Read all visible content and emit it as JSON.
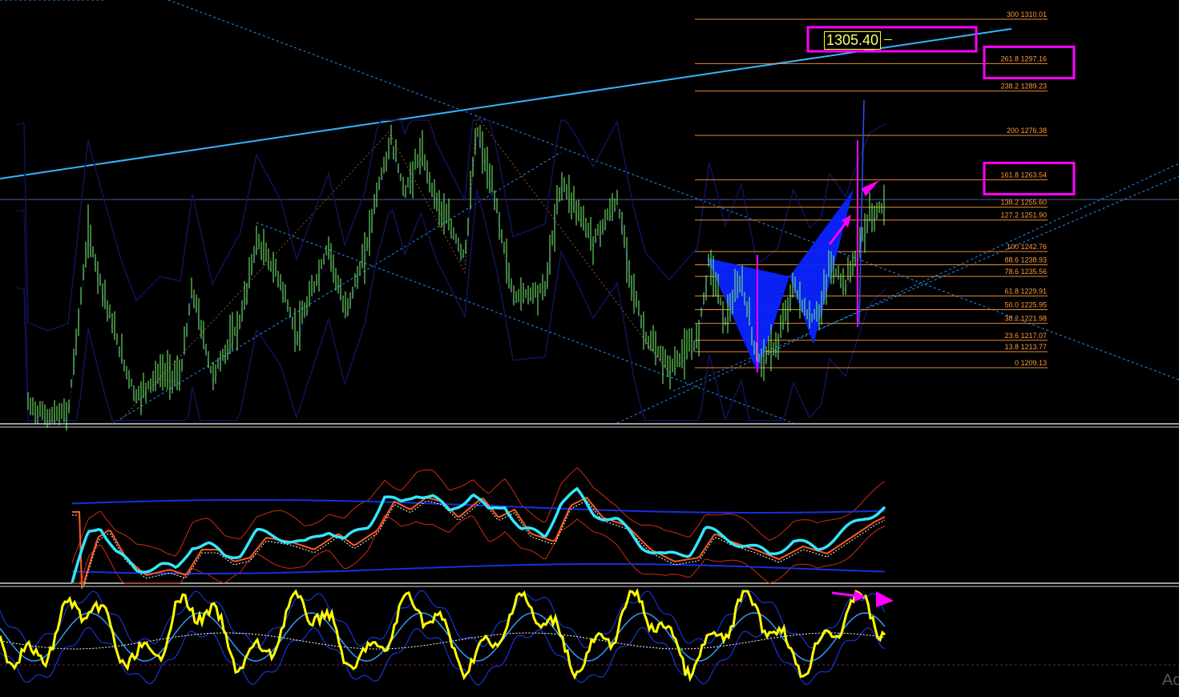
{
  "price_tag": "1305.40",
  "watermark": "Ac",
  "colors": {
    "candle": "#7dff6b",
    "channel": "#1e90ff",
    "trendline": "#33b5ff",
    "bollinger": "#12125a",
    "fib": "#ff9a3a",
    "highlight": "#ff00ff",
    "pattern": "#0a23ff",
    "rsi_main": "#33e6ff",
    "rsi_signal": "#ff5a1a",
    "stoch_main": "#ffff00",
    "stoch_signal": "#3399ff"
  },
  "chart_data": {
    "type": "line",
    "panels": [
      "price",
      "oscillator",
      "stochastic"
    ],
    "fibonacci_levels": [
      {
        "level": "300",
        "price": "1310.01",
        "label": "300 1310.01"
      },
      {
        "level": "261.8",
        "price": "1297.16",
        "label": "261.8 1297.16",
        "highlighted": true
      },
      {
        "level": "238.2",
        "price": "1289.23",
        "label": "238.2 1289.23"
      },
      {
        "level": "200",
        "price": "1276.38",
        "label": "200 1276.38"
      },
      {
        "level": "161.8",
        "price": "1263.54",
        "label": "161.8 1263.54",
        "highlighted": true
      },
      {
        "level": "138.2",
        "price": "1255.60",
        "label": "138.2 1255.60"
      },
      {
        "level": "127.2",
        "price": "1251.90",
        "label": "127.2 1251.90"
      },
      {
        "level": "100",
        "price": "1242.76",
        "label": "100 1242.76"
      },
      {
        "level": "88.6",
        "price": "1238.93",
        "label": "88.6 1238.93"
      },
      {
        "level": "78.6",
        "price": "1235.56",
        "label": "78.6 1235.56"
      },
      {
        "level": "61.8",
        "price": "1229.91",
        "label": "61.8 1229.91"
      },
      {
        "level": "50.0",
        "price": "1225.95",
        "label": "50.0 1225.95"
      },
      {
        "level": "38.2",
        "price": "1221.98",
        "label": "38.2 1221.98"
      },
      {
        "level": "23.6",
        "price": "1217.07",
        "label": "23.6 1217.07"
      },
      {
        "level": "13.8",
        "price": "1213.77",
        "label": "13.8 1213.77"
      },
      {
        "level": "0",
        "price": "1209.13",
        "label": "0 1209.13"
      }
    ],
    "current_price": 1305.4,
    "grid": false
  }
}
